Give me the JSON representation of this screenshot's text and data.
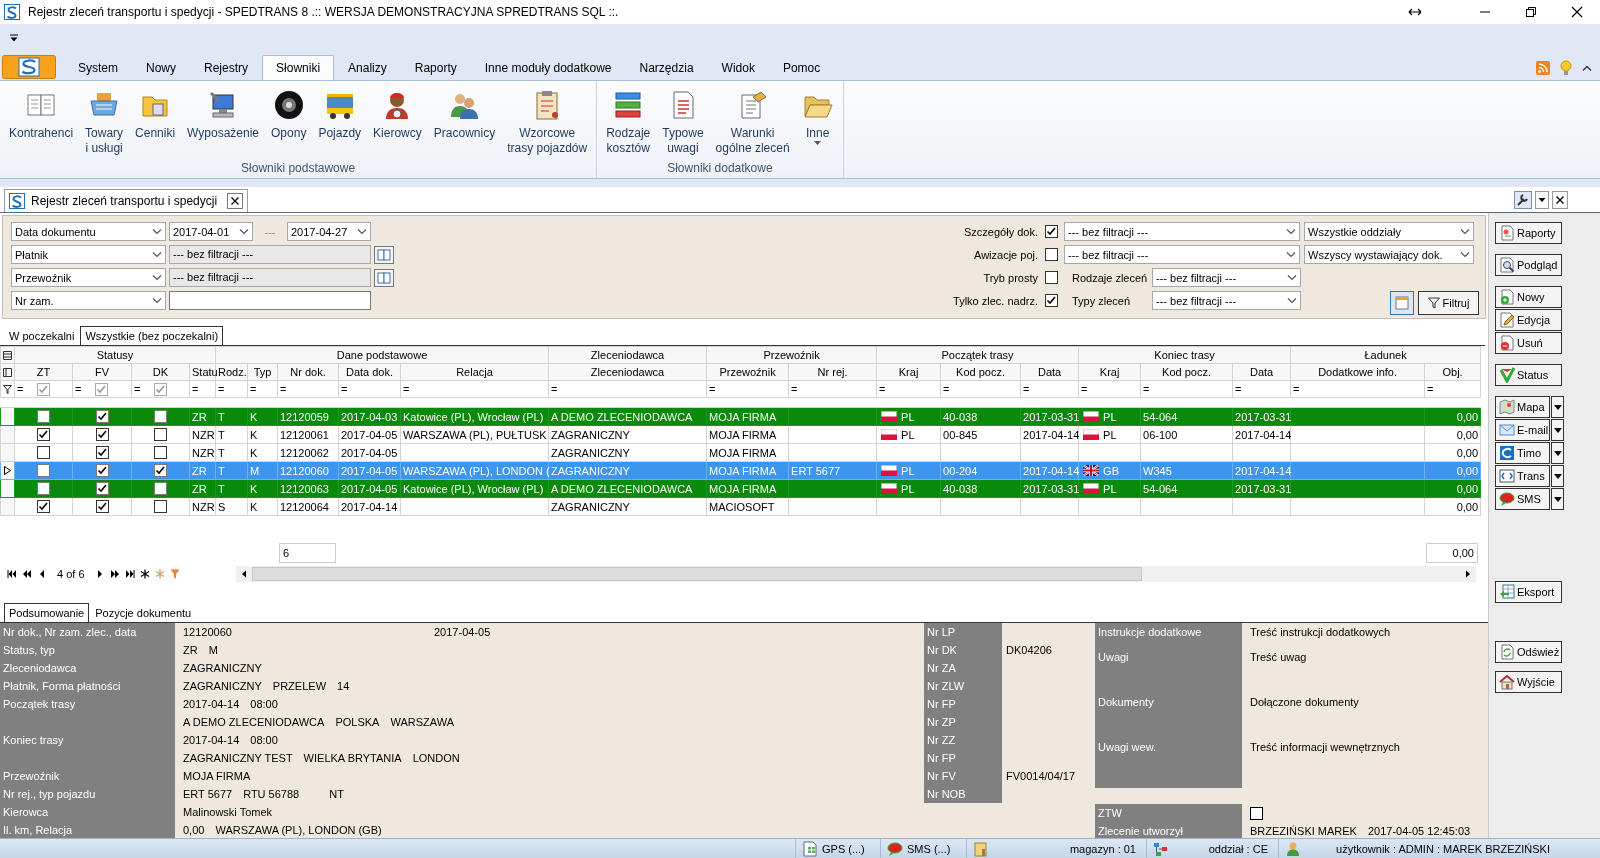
{
  "window": {
    "title": "Rejestr zleceń transportu i spedycji - SPEDTRANS 8 .:: WERSJA DEMONSTRACYJNA SPREDTRANS SQL ::."
  },
  "ribbon": {
    "tabs": [
      {
        "label": "System",
        "selected": false
      },
      {
        "label": "Nowy",
        "selected": false
      },
      {
        "label": "Rejestry",
        "selected": false
      },
      {
        "label": "Słowniki",
        "selected": true
      },
      {
        "label": "Analizy",
        "selected": false
      },
      {
        "label": "Raporty",
        "selected": false
      },
      {
        "label": "Inne moduły dodatkowe",
        "selected": false
      },
      {
        "label": "Narzędzia",
        "selected": false
      },
      {
        "label": "Widok",
        "selected": false
      },
      {
        "label": "Pomoc",
        "selected": false
      }
    ],
    "groups": [
      {
        "label": "Słowniki podstawowe",
        "items": [
          {
            "lines": [
              "Kontrahenci"
            ]
          },
          {
            "lines": [
              "Towary",
              "i usługi"
            ]
          },
          {
            "lines": [
              "Cenniki"
            ]
          },
          {
            "lines": [
              "Wyposażenie"
            ]
          },
          {
            "lines": [
              "Opony"
            ]
          },
          {
            "lines": [
              "Pojazdy"
            ]
          },
          {
            "lines": [
              "Kierowcy"
            ]
          },
          {
            "lines": [
              "Pracownicy"
            ]
          },
          {
            "lines": [
              "Wzorcowe",
              "trasy pojazdów"
            ]
          }
        ]
      },
      {
        "label": "Słowniki dodatkowe",
        "items": [
          {
            "lines": [
              "Rodzaje",
              "kosztów"
            ]
          },
          {
            "lines": [
              "Typowe",
              "uwagi"
            ]
          },
          {
            "lines": [
              "Warunki",
              "ogólne zleceń"
            ]
          },
          {
            "lines": [
              "Inne"
            ],
            "dropdown": true
          }
        ]
      }
    ]
  },
  "document_tab": {
    "title": "Rejestr zleceń transportu i spedycji"
  },
  "filters": {
    "left": [
      {
        "kind": "date-range",
        "field": "Data dokumentu",
        "from": "2017-04-01",
        "separator": "---",
        "to": "2017-04-27"
      },
      {
        "kind": "lookup",
        "field": "Płatnik",
        "value": "--- bez filtracji ---"
      },
      {
        "kind": "lookup",
        "field": "Przewoźnik",
        "value": "--- bez filtracji ---"
      },
      {
        "kind": "text",
        "field": "Nr zam."
      }
    ],
    "right": [
      {
        "label": "Szczegóły dok.",
        "checked": true,
        "value": "--- bez filtracji ---",
        "scope": "Wszystkie oddziały"
      },
      {
        "label": "Awizacje poj.",
        "checked": false,
        "value": "--- bez filtracji ---",
        "scope": "Wszyscy wystawiający dok."
      },
      {
        "label": "Tryb prosty",
        "checked": false,
        "value_label": "Rodzaje zleceń",
        "value": "--- bez filtracji ---"
      },
      {
        "label": "Tylko zlec. nadrz.",
        "checked": true,
        "value_label": "Typy zleceń",
        "value": "--- bez filtracji ---"
      }
    ],
    "filter_button": "Filtruj"
  },
  "subtabs": [
    {
      "label": "W poczekalni",
      "selected": false
    },
    {
      "label": "Wszystkie (bez poczekalni)",
      "selected": true
    }
  ],
  "grid": {
    "groups": [
      {
        "label": "Statusy",
        "columns": [
          {
            "header": "ZT",
            "kind": "check",
            "filter": "=",
            "filter_checked": true
          },
          {
            "header": "FV",
            "kind": "check",
            "filter": "=",
            "filter_checked": true
          },
          {
            "header": "DK",
            "kind": "check",
            "filter": "=",
            "filter_checked": true
          },
          {
            "header": "Statu",
            "kind": "text",
            "filter": "="
          }
        ]
      },
      {
        "label": "Dane podstawowe",
        "columns": [
          {
            "header": "Rodz.",
            "kind": "text",
            "filter": "="
          },
          {
            "header": "Typ",
            "kind": "text",
            "filter": "="
          },
          {
            "header": "Nr dok.",
            "kind": "text",
            "filter": "=",
            "footer": "6"
          },
          {
            "header": "Data dok.",
            "kind": "text",
            "filter": "="
          },
          {
            "header": "Relacja",
            "kind": "text",
            "filter": "="
          }
        ]
      },
      {
        "label": "Zleceniodawca",
        "columns": [
          {
            "header": "Zleceniodawca",
            "kind": "text",
            "filter": "="
          }
        ]
      },
      {
        "label": "Przewoźnik",
        "columns": [
          {
            "header": "Przewoźnik",
            "kind": "text",
            "filter": "="
          },
          {
            "header": "Nr rej.",
            "kind": "text",
            "filter": "="
          }
        ]
      },
      {
        "label": "Początek trasy",
        "columns": [
          {
            "header": "Kraj",
            "kind": "country",
            "filter": "="
          },
          {
            "header": "Kod pocz.",
            "kind": "text",
            "filter": "="
          },
          {
            "header": "Data",
            "kind": "text",
            "filter": "="
          }
        ]
      },
      {
        "label": "Koniec trasy",
        "columns": [
          {
            "header": "Kraj",
            "kind": "country",
            "filter": "="
          },
          {
            "header": "Kod pocz.",
            "kind": "text",
            "filter": "="
          },
          {
            "header": "Data",
            "kind": "text",
            "filter": "="
          }
        ]
      },
      {
        "label": "Ładunek",
        "columns": [
          {
            "header": "Dodatkowe info.",
            "kind": "text",
            "filter": "="
          },
          {
            "header": "Obj.",
            "kind": "number",
            "filter": "=",
            "footer": "0,00"
          }
        ]
      }
    ],
    "rows": [
      {
        "selected": false,
        "color": "#0a8a0a",
        "cells": [
          false,
          true,
          false,
          "ZR",
          "T",
          "K",
          "12120059",
          "2017-04-03",
          "Katowice (PL), Wrocław (PL)",
          "A DEMO ZLECENIODAWCA",
          "MOJA FIRMA",
          null,
          {
            "kind": "pl",
            "text": "PL"
          },
          "40-038",
          "2017-03-31",
          {
            "kind": "pl",
            "text": "PL"
          },
          "54-064",
          "2017-03-31",
          null,
          "0,00"
        ]
      },
      {
        "selected": false,
        "cells": [
          true,
          true,
          false,
          "NZR",
          "T",
          "K",
          "12120061",
          "2017-04-05",
          "WARSZAWA (PL), PUŁTUSK",
          "ZAGRANICZNY",
          "MOJA FIRMA",
          null,
          {
            "kind": "pl",
            "text": "PL"
          },
          "00-845",
          "2017-04-14",
          {
            "kind": "pl",
            "text": "PL"
          },
          "06-100",
          "2017-04-14",
          null,
          "0,00"
        ]
      },
      {
        "selected": false,
        "cells": [
          false,
          true,
          false,
          "NZR",
          "T",
          "K",
          "12120062",
          "2017-04-05",
          null,
          "ZAGRANICZNY",
          "MOJA FIRMA",
          null,
          null,
          null,
          null,
          null,
          null,
          null,
          null,
          "0,00"
        ]
      },
      {
        "selected": true,
        "cells": [
          false,
          true,
          true,
          "ZR",
          "T",
          "M",
          "12120060",
          "2017-04-05",
          "WARSZAWA (PL), LONDON (",
          "ZAGRANICZNY",
          "MOJA FIRMA",
          "ERT 5677",
          {
            "kind": "pl",
            "text": "PL"
          },
          "00-204",
          "2017-04-14",
          {
            "kind": "gb",
            "text": "GB"
          },
          "W345",
          "2017-04-14",
          null,
          "0,00"
        ]
      },
      {
        "selected": false,
        "color": "#0a8a0a",
        "cells": [
          false,
          true,
          false,
          "ZR",
          "T",
          "K",
          "12120063",
          "2017-04-05",
          "Katowice (PL), Wrocław (PL)",
          "A DEMO ZLECENIODAWCA",
          "MOJA FIRMA",
          null,
          {
            "kind": "pl",
            "text": "PL"
          },
          "40-038",
          "2017-03-31",
          {
            "kind": "pl",
            "text": "PL"
          },
          "54-064",
          "2017-03-31",
          null,
          "0,00"
        ]
      },
      {
        "selected": false,
        "cells": [
          true,
          true,
          false,
          "NZR",
          "S",
          "K",
          "12120064",
          "2017-04-14",
          null,
          "ZAGRANICZNY",
          "MACIOSOFT",
          null,
          null,
          null,
          null,
          null,
          null,
          null,
          null,
          "0,00"
        ]
      }
    ],
    "navigator": {
      "position": "4 of 6"
    }
  },
  "bottom_tabs": [
    {
      "label": "Podsumowanie",
      "selected": true
    },
    {
      "label": "Pozycje dokumentu",
      "selected": false
    }
  ],
  "summary": {
    "fields": [
      {
        "label": "Nr dok., Nr zam. zlec., data",
        "values": [
          "12120060"
        ],
        "date": "2017-04-05"
      },
      {
        "label": "Status, typ",
        "values": [
          "ZR",
          "M"
        ]
      },
      {
        "label": "Zleceniodawca",
        "values": [
          "ZAGRANICZNY"
        ]
      },
      {
        "label": "Płatnik, Forma płatności",
        "values": [
          "ZAGRANICZNY",
          "PRZELEW",
          "14"
        ]
      },
      {
        "label": "Początek trasy",
        "values": [
          "2017-04-14",
          "08:00"
        ]
      },
      {
        "values": [
          "A DEMO ZLECENIODAWCA",
          "POLSKA",
          "WARSZAWA"
        ]
      },
      {
        "label": "Koniec trasy",
        "values": [
          "2017-04-14",
          "08:00"
        ]
      },
      {
        "values": [
          "ZAGRANICZNY TEST",
          "WIELKA BRYTANIA",
          "LONDON"
        ]
      },
      {
        "label": "Przewoźnik",
        "values": [
          "MOJA FIRMA"
        ]
      },
      {
        "label": "Nr rej., typ pojazdu",
        "values": [
          "ERT 5677",
          "RTU 56788"
        ],
        "vehicle_type": "NT"
      },
      {
        "label": "Kierowca",
        "values": [
          "Malinowski Tomek"
        ]
      },
      {
        "label": "Il. km, Relacja",
        "values": [
          "0,00",
          "WARSZAWA (PL), LONDON (GB)"
        ]
      }
    ],
    "document_numbers": [
      {
        "label": "Nr LP"
      },
      {
        "label": "Nr DK",
        "value": "DK04206"
      },
      {
        "label": "Nr ZA"
      },
      {
        "label": "Nr ZLW"
      },
      {
        "label": "Nr FP"
      },
      {
        "label": "Nr ZP"
      },
      {
        "label": "Nr ZZ"
      },
      {
        "label": "Nr FP"
      },
      {
        "label": "Nr FV",
        "value": "FV0014/04/17"
      },
      {
        "label": "Nr NOB"
      }
    ],
    "notes": [
      {
        "kind": "line",
        "label": "Instrukcje dodatkowe",
        "value": "Treść instrukcji dodatkowych"
      },
      {
        "kind": "memo",
        "label": "Uwagi",
        "value": "Treść uwag"
      },
      {
        "kind": "memo",
        "label": "Dokumenty",
        "value": "Dołączone dokumenty"
      },
      {
        "kind": "memo",
        "label": "Uwagi wew.",
        "value": "Treść informacji wewnętrznych"
      }
    ],
    "record": [
      {
        "kind": "check",
        "label": "ZTW",
        "checked": false
      },
      {
        "kind": "line",
        "label": "Zlecenie utworzył",
        "values": [
          "BRZEZIŃSKI MAREK",
          "2017-04-05 12:45:03"
        ]
      }
    ]
  },
  "sidebar": {
    "actions": [
      {
        "buttons": [
          {
            "label": "Raporty"
          }
        ]
      },
      {
        "buttons": [
          {
            "label": "Podgląd"
          }
        ]
      },
      {
        "buttons": [
          {
            "label": "Nowy"
          },
          {
            "label": "Edycja"
          },
          {
            "label": "Usuń"
          }
        ]
      },
      {
        "buttons": [
          {
            "label": "Status"
          }
        ]
      },
      {
        "buttons": [
          {
            "label": "Mapa",
            "dropdown": true
          },
          {
            "label": "E-mail",
            "dropdown": true
          },
          {
            "label": "Timo",
            "dropdown": true
          },
          {
            "label": "Trans",
            "dropdown": true
          },
          {
            "label": "SMS",
            "dropdown": true
          }
        ]
      }
    ],
    "export": [
      {
        "buttons": [
          {
            "label": "Eksport"
          }
        ]
      }
    ],
    "closing": [
      {
        "buttons": [
          {
            "label": "Odśwież"
          }
        ]
      },
      {
        "buttons": [
          {
            "label": "Wyjście"
          }
        ]
      }
    ]
  },
  "status_bar": [
    {
      "text": "GPS (...)"
    },
    {
      "text": "SMS (...)"
    },
    {
      "text": "magazyn : 01"
    },
    {
      "text": "oddział : CE"
    },
    {
      "text": "użytkownik : ADMIN : MAREK BRZEZIŃSKI"
    }
  ]
}
